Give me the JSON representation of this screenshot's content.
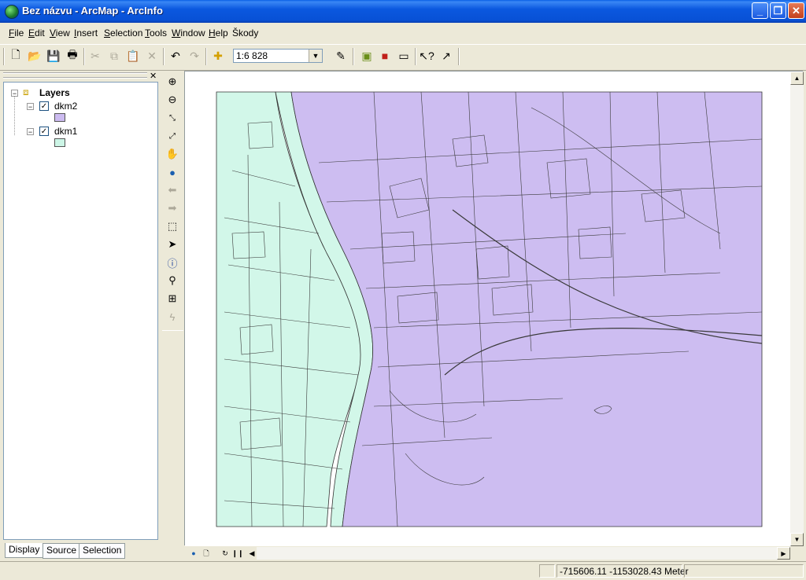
{
  "window": {
    "title": "Bez názvu - ArcMap - ArcInfo"
  },
  "menu": [
    {
      "label": "File",
      "u": "F",
      "rest": "ile"
    },
    {
      "label": "Edit",
      "u": "E",
      "rest": "dit"
    },
    {
      "label": "View",
      "u": "V",
      "rest": "iew"
    },
    {
      "label": "Insert",
      "u": "I",
      "rest": "nsert"
    },
    {
      "label": "Selection",
      "u": "S",
      "rest": "election"
    },
    {
      "label": "Tools",
      "u": "T",
      "rest": "ools"
    },
    {
      "label": "Window",
      "u": "W",
      "rest": "indow"
    },
    {
      "label": "Help",
      "u": "H",
      "rest": "elp"
    },
    {
      "label": "Škody",
      "u": "",
      "rest": "Škody"
    }
  ],
  "toolbar": {
    "scale": "1:6 828",
    "icons": [
      "new-document-icon",
      "open-folder-icon",
      "save-icon",
      "print-icon",
      "cut-icon",
      "copy-icon",
      "paste-icon",
      "delete-icon",
      "undo-icon",
      "redo-icon",
      "add-data-icon",
      "editor-toolbar-icon",
      "arccatalog-icon",
      "arctoolbox-icon",
      "command-line-icon",
      "whats-this-icon",
      "identify-pointer-icon"
    ]
  },
  "toc": {
    "root": "Layers",
    "layers": [
      {
        "name": "dkm2",
        "checked": true,
        "fill": "#ccbbf0"
      },
      {
        "name": "dkm1",
        "checked": true,
        "fill": "#ccf5e6"
      }
    ],
    "tabs": [
      "Display",
      "Source",
      "Selection"
    ],
    "active_tab": "Display"
  },
  "tools": [
    "zoom-in-icon",
    "zoom-out-icon",
    "fixed-zoom-in-icon",
    "fixed-zoom-out-icon",
    "pan-icon",
    "full-extent-icon",
    "back-extent-icon",
    "forward-extent-icon",
    "select-features-icon",
    "select-elements-icon",
    "identify-icon",
    "find-icon",
    "measure-icon",
    "hyperlink-icon"
  ],
  "colors": {
    "dkm2_fill": "#cdbdf1",
    "dkm1_fill": "#d2f7e9",
    "parcel_line": "#3a3a3a"
  },
  "status": {
    "coordinates": "-715606.11  -1153028.43 Meter"
  }
}
